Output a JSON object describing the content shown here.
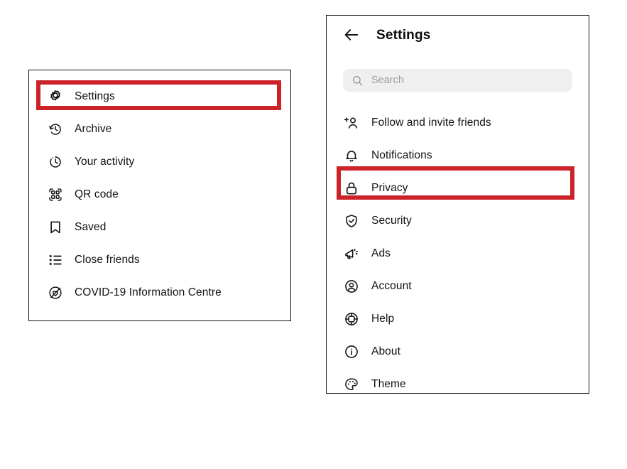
{
  "left_panel": {
    "name": "instagram-profile-menu",
    "items": [
      {
        "label": "Settings",
        "icon": "gear-icon",
        "highlighted": true
      },
      {
        "label": "Archive",
        "icon": "archive-clock-icon",
        "highlighted": false
      },
      {
        "label": "Your activity",
        "icon": "activity-clock-icon",
        "highlighted": false
      },
      {
        "label": "QR code",
        "icon": "qr-code-icon",
        "highlighted": false
      },
      {
        "label": "Saved",
        "icon": "bookmark-icon",
        "highlighted": false
      },
      {
        "label": "Close friends",
        "icon": "close-friends-list-icon",
        "highlighted": false
      },
      {
        "label": "COVID-19 Information Centre",
        "icon": "covid-heart-icon",
        "highlighted": false
      }
    ]
  },
  "right_panel": {
    "name": "instagram-settings-screen",
    "header": {
      "back_icon": "back-arrow-icon",
      "title": "Settings"
    },
    "search": {
      "icon": "search-icon",
      "value": "",
      "placeholder": "Search"
    },
    "items": [
      {
        "label": "Follow and invite friends",
        "icon": "add-person-icon",
        "highlighted": false
      },
      {
        "label": "Notifications",
        "icon": "bell-icon",
        "highlighted": false
      },
      {
        "label": "Privacy",
        "icon": "lock-icon",
        "highlighted": true
      },
      {
        "label": "Security",
        "icon": "shield-check-icon",
        "highlighted": false
      },
      {
        "label": "Ads",
        "icon": "megaphone-icon",
        "highlighted": false
      },
      {
        "label": "Account",
        "icon": "account-circle-icon",
        "highlighted": false
      },
      {
        "label": "Help",
        "icon": "lifebuoy-icon",
        "highlighted": false
      },
      {
        "label": "About",
        "icon": "info-circle-icon",
        "highlighted": false
      },
      {
        "label": "Theme",
        "icon": "palette-icon",
        "highlighted": false
      }
    ]
  },
  "colors": {
    "highlight": "#cc2229",
    "panel_border": "#111111",
    "text": "#121212",
    "search_background": "#efefef",
    "placeholder": "#9c9c9c"
  }
}
